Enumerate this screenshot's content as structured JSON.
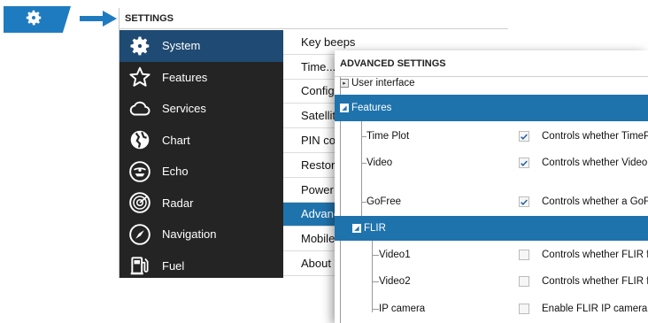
{
  "colors": {
    "accent": "#1f7bbf",
    "sidebar_bg": "#242424",
    "sidebar_active": "#1f4a73",
    "selection": "#1f73ad"
  },
  "badge": {
    "icon": "gear-icon"
  },
  "settings": {
    "title": "SETTINGS",
    "sidebar": [
      {
        "label": "System",
        "icon": "gear-icon",
        "active": true
      },
      {
        "label": "Features",
        "icon": "star-icon"
      },
      {
        "label": "Services",
        "icon": "cloud-icon"
      },
      {
        "label": "Chart",
        "icon": "chart-icon"
      },
      {
        "label": "Echo",
        "icon": "echo-icon"
      },
      {
        "label": "Radar",
        "icon": "radar-icon"
      },
      {
        "label": "Navigation",
        "icon": "compass-icon"
      },
      {
        "label": "Fuel",
        "icon": "fuel-pump-icon"
      }
    ],
    "menu": [
      {
        "label": "Key beeps"
      },
      {
        "label": "Time..."
      },
      {
        "label": "Configu"
      },
      {
        "label": "Satellite"
      },
      {
        "label": "PIN cod"
      },
      {
        "label": "Restore"
      },
      {
        "label": "Power c"
      },
      {
        "label": "Advanc",
        "active": true
      },
      {
        "label": "Mobile"
      },
      {
        "label": "About"
      }
    ]
  },
  "advanced": {
    "title": "ADVANCED SETTINGS",
    "rows": [
      {
        "label": "User interface",
        "kind": "collapsed"
      },
      {
        "label": "Features",
        "kind": "expanded",
        "selected": true
      },
      {
        "label": "Time Plot",
        "checked": true,
        "desc": "Controls whether TimePlo"
      },
      {
        "label": "Video",
        "checked": true,
        "desc": "Controls whether Video fe"
      },
      {
        "label": "GoFree",
        "checked": true,
        "desc": "Controls whether a GoFree"
      },
      {
        "label": "FLIR",
        "kind": "expanded",
        "selected": true
      },
      {
        "label": "Video1",
        "checked": false,
        "desc": "Controls whether FLIR feat"
      },
      {
        "label": "Video2",
        "checked": false,
        "desc": "Controls whether FLIR feat"
      },
      {
        "label": "IP camera",
        "checked": false,
        "desc": "Enable FLIR IP camera wit"
      }
    ]
  }
}
